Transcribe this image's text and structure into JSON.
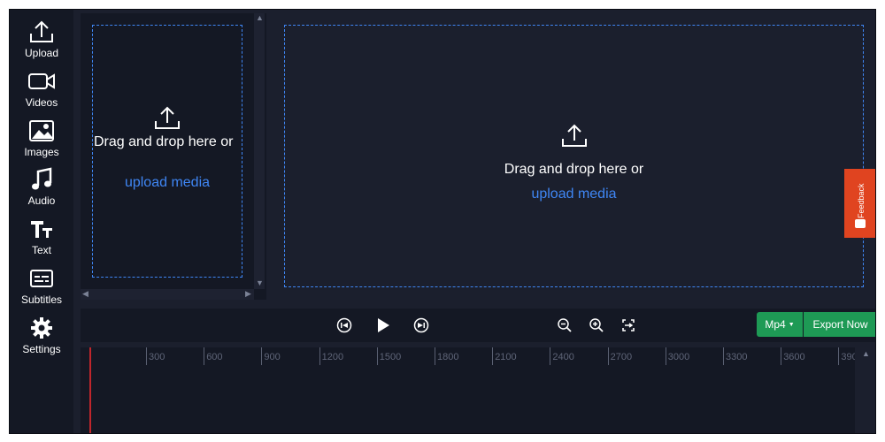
{
  "sidebar": {
    "items": [
      {
        "label": "Upload",
        "icon": "upload-icon"
      },
      {
        "label": "Videos",
        "icon": "video-camera-icon"
      },
      {
        "label": "Images",
        "icon": "image-icon"
      },
      {
        "label": "Audio",
        "icon": "music-note-icon"
      },
      {
        "label": "Text",
        "icon": "text-icon"
      },
      {
        "label": "Subtitles",
        "icon": "subtitles-icon"
      },
      {
        "label": "Settings",
        "icon": "gear-icon"
      }
    ]
  },
  "media_panel": {
    "drop_text": "Drag and drop here or",
    "upload_link": "upload media"
  },
  "preview": {
    "drop_text": "Drag and drop here or",
    "upload_link": "upload media"
  },
  "feedback": {
    "label": "Feedback"
  },
  "controls": {
    "format_label": "Mp4",
    "export_label": "Export Now"
  },
  "timeline": {
    "ruler": [
      "300",
      "600",
      "900",
      "1200",
      "1500",
      "1800",
      "2100",
      "2400",
      "2700",
      "3000",
      "3300",
      "3600",
      "390"
    ]
  },
  "colors": {
    "accent": "#3f86f4",
    "export": "#1e9a55",
    "feedback": "#e04420",
    "playhead": "#c0262c"
  }
}
